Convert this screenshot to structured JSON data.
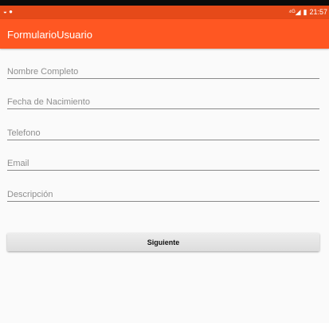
{
  "status_bar": {
    "signal": "⁴ᴳ◢",
    "battery": "▮",
    "time": "21:57"
  },
  "app_bar": {
    "title": "FormularioUsuario"
  },
  "form": {
    "fields": [
      {
        "placeholder": "Nombre Completo",
        "value": ""
      },
      {
        "placeholder": "Fecha de Nacimiento",
        "value": ""
      },
      {
        "placeholder": "Telefono",
        "value": ""
      },
      {
        "placeholder": "Email",
        "value": ""
      },
      {
        "placeholder": "Descripción",
        "value": ""
      }
    ],
    "submit_label": "Siguiente"
  },
  "colors": {
    "status_bar": "#e64a19",
    "app_bar": "#ff5722",
    "background": "#fafafa"
  }
}
